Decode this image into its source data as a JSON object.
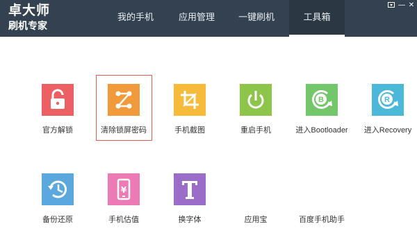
{
  "app": {
    "logo_line1": "卓大师",
    "logo_line2": "刷机专家"
  },
  "nav": {
    "tabs": [
      {
        "label": "我的手机",
        "active": false
      },
      {
        "label": "应用管理",
        "active": false
      },
      {
        "label": "一键刷机",
        "active": false
      },
      {
        "label": "工具箱",
        "active": true
      }
    ]
  },
  "window_controls": {
    "menu_icon": "dropdown-menu-icon",
    "minimize": "—",
    "close": "✕"
  },
  "tools": [
    {
      "label": "官方解锁",
      "icon": "unlock-icon",
      "color": "#ec5f63"
    },
    {
      "label": "清除锁屏密码",
      "icon": "pattern-lock-icon",
      "color": "#f19a3b",
      "selected": true
    },
    {
      "label": "手机截图",
      "icon": "crop-icon",
      "color": "#f6bb3a"
    },
    {
      "label": "重启手机",
      "icon": "power-icon",
      "color": "#8cc54a"
    },
    {
      "label": "进入Bootloader",
      "icon": "bootloader-icon",
      "color": "#73c66a"
    },
    {
      "label": "进入Recovery",
      "icon": "recovery-icon",
      "color": "#4cb8d9"
    },
    {
      "label": "备份还原",
      "icon": "backup-restore-icon",
      "color": "#5ba8de"
    },
    {
      "label": "手机估值",
      "icon": "phone-value-icon",
      "color": "#ec7ab4"
    },
    {
      "label": "换字体",
      "icon": "font-icon",
      "color": "#9a6ec8"
    },
    {
      "label": "应用宝",
      "icon": "",
      "color": ""
    },
    {
      "label": "百度手机助手",
      "icon": "",
      "color": ""
    }
  ]
}
